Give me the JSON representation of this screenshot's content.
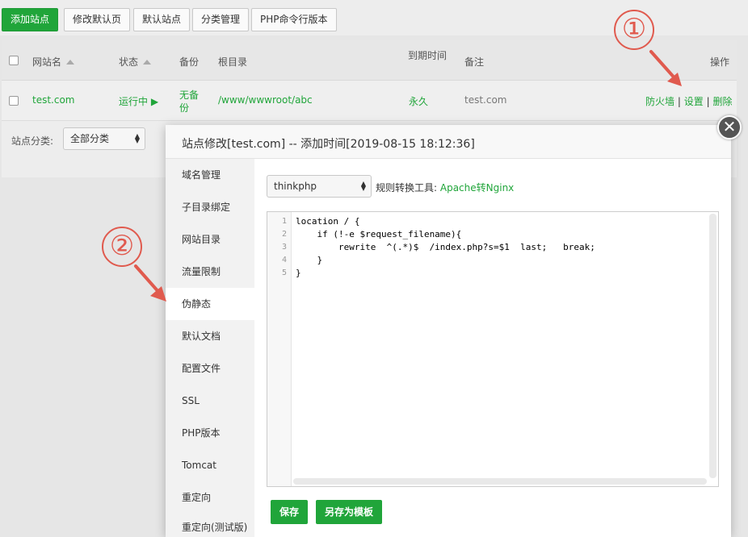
{
  "toolbar": {
    "add_site": "添加站点",
    "edit_default_page": "修改默认页",
    "default_site": "默认站点",
    "category_manage": "分类管理",
    "php_cli_version": "PHP命令行版本"
  },
  "table": {
    "headers": {
      "site_name": "网站名",
      "status": "状态",
      "backup": "备份",
      "root_dir": "根目录",
      "expire": "到期时间",
      "remark": "备注",
      "actions": "操作"
    },
    "row": {
      "site_name": "test.com",
      "status": "运行中 ▶",
      "backup_line1": "无备",
      "backup_line2": "份",
      "root_dir": "/www/wwwroot/abc",
      "expire": "永久",
      "remark": "test.com",
      "action_firewall": "防火墙",
      "sep1": "|",
      "action_settings": "设置",
      "sep2": "|",
      "action_delete": "删除"
    },
    "category": {
      "label": "站点分类:",
      "selected": "全部分类"
    }
  },
  "callouts": {
    "one": "①",
    "two": "②"
  },
  "modal": {
    "title": "站点修改[test.com] -- 添加时间[2019-08-15 18:12:36]",
    "close_glyph": "✕",
    "menu": [
      {
        "label": "域名管理"
      },
      {
        "label": "子目录绑定"
      },
      {
        "label": "网站目录"
      },
      {
        "label": "流量限制"
      },
      {
        "label": "伪静态"
      },
      {
        "label": "默认文档"
      },
      {
        "label": "配置文件"
      },
      {
        "label": "SSL"
      },
      {
        "label": "PHP版本"
      },
      {
        "label": "Tomcat"
      },
      {
        "label": "重定向"
      },
      {
        "label": "重定向(测试版)"
      }
    ],
    "template_select": "thinkphp",
    "converter_label": "规则转换工具:",
    "converter_link": "Apache转Nginx",
    "editor": {
      "line_numbers": [
        "1",
        "2",
        "3",
        "4",
        "5"
      ],
      "lines": [
        "location / {",
        "    if (!-e $request_filename){",
        "        rewrite  ^(.*)$  /index.php?s=$1  last;   break;",
        "    }",
        "}"
      ]
    },
    "save_button": "保存",
    "save_template_button": "另存为模板"
  },
  "colors": {
    "accent": "#20a53a",
    "callout": "#e05a4e"
  }
}
